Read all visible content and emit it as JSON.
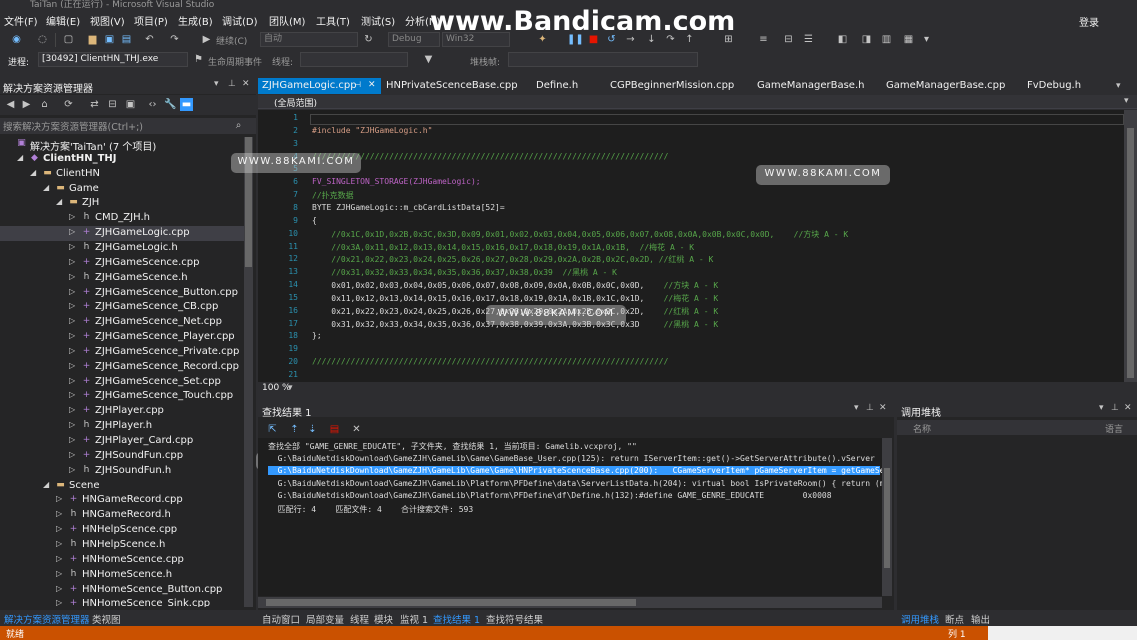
{
  "window": {
    "title": "TaiTan (正在运行) - Microsoft Visual Studio"
  },
  "watermarks": {
    "top": "www.Bandicam.com",
    "site": "WWW.88KAMI.COM"
  },
  "menu": {
    "items": [
      "文件(F)",
      "编辑(E)",
      "视图(V)",
      "项目(P)",
      "生成(B)",
      "调试(D)",
      "团队(M)",
      "工具(T)",
      "测试(S)",
      "分析(N)"
    ],
    "login": "登录"
  },
  "toolbar": {
    "continue_label": "继续(C)",
    "auto_combo": "自动",
    "config_combo": "Debug",
    "platform_combo": "Win32",
    "process_label": "进程:",
    "process_value": "[30492] ClientHN_THJ.exe",
    "lifecycle_label": "生命周期事件",
    "thread_label": "线程:",
    "stackframe_label": "堆栈帧:"
  },
  "solution_explorer": {
    "title": "解决方案资源管理器",
    "search_placeholder": "搜索解决方案资源管理器(Ctrl+;)",
    "tree": [
      {
        "label": "解决方案'TaiTan' (7 个项目)",
        "indent": 0,
        "icon": "solution-icon",
        "arrow": ""
      },
      {
        "label": "ClientHN_THJ",
        "indent": 1,
        "icon": "project-icon",
        "arrow": "◢",
        "bold": true
      },
      {
        "label": "ClientHN",
        "indent": 2,
        "icon": "folder-icon",
        "arrow": "◢"
      },
      {
        "label": "Game",
        "indent": 3,
        "icon": "folder-icon",
        "arrow": "◢"
      },
      {
        "label": "ZJH",
        "indent": 4,
        "icon": "folder-icon",
        "arrow": "◢"
      },
      {
        "label": "CMD_ZJH.h",
        "indent": 5,
        "icon": "header-icon",
        "arrow": "▷"
      },
      {
        "label": "ZJHGameLogic.cpp",
        "indent": 5,
        "icon": "cpp-icon",
        "arrow": "▷",
        "selected": true
      },
      {
        "label": "ZJHGameLogic.h",
        "indent": 5,
        "icon": "header-icon",
        "arrow": "▷"
      },
      {
        "label": "ZJHGameScence.cpp",
        "indent": 5,
        "icon": "cpp-icon",
        "arrow": "▷"
      },
      {
        "label": "ZJHGameScence.h",
        "indent": 5,
        "icon": "header-icon",
        "arrow": "▷"
      },
      {
        "label": "ZJHGameScence_Button.cpp",
        "indent": 5,
        "icon": "cpp-icon",
        "arrow": "▷"
      },
      {
        "label": "ZJHGameScence_CB.cpp",
        "indent": 5,
        "icon": "cpp-icon",
        "arrow": "▷"
      },
      {
        "label": "ZJHGameScence_Net.cpp",
        "indent": 5,
        "icon": "cpp-icon",
        "arrow": "▷"
      },
      {
        "label": "ZJHGameScence_Player.cpp",
        "indent": 5,
        "icon": "cpp-icon",
        "arrow": "▷"
      },
      {
        "label": "ZJHGameScence_Private.cpp",
        "indent": 5,
        "icon": "cpp-icon",
        "arrow": "▷"
      },
      {
        "label": "ZJHGameScence_Record.cpp",
        "indent": 5,
        "icon": "cpp-icon",
        "arrow": "▷"
      },
      {
        "label": "ZJHGameScence_Set.cpp",
        "indent": 5,
        "icon": "cpp-icon",
        "arrow": "▷"
      },
      {
        "label": "ZJHGameScence_Touch.cpp",
        "indent": 5,
        "icon": "cpp-icon",
        "arrow": "▷"
      },
      {
        "label": "ZJHPlayer.cpp",
        "indent": 5,
        "icon": "cpp-icon",
        "arrow": "▷"
      },
      {
        "label": "ZJHPlayer.h",
        "indent": 5,
        "icon": "header-icon",
        "arrow": "▷"
      },
      {
        "label": "ZJHPlayer_Card.cpp",
        "indent": 5,
        "icon": "cpp-icon",
        "arrow": "▷"
      },
      {
        "label": "ZJHSoundFun.cpp",
        "indent": 5,
        "icon": "cpp-icon",
        "arrow": "▷"
      },
      {
        "label": "ZJHSoundFun.h",
        "indent": 5,
        "icon": "header-icon",
        "arrow": "▷"
      },
      {
        "label": "Scene",
        "indent": 3,
        "icon": "folder-icon",
        "arrow": "◢"
      },
      {
        "label": "HNGameRecord.cpp",
        "indent": 4,
        "icon": "cpp-icon",
        "arrow": "▷"
      },
      {
        "label": "HNGameRecord.h",
        "indent": 4,
        "icon": "header-icon",
        "arrow": "▷"
      },
      {
        "label": "HNHelpScence.cpp",
        "indent": 4,
        "icon": "cpp-icon",
        "arrow": "▷"
      },
      {
        "label": "HNHelpScence.h",
        "indent": 4,
        "icon": "header-icon",
        "arrow": "▷"
      },
      {
        "label": "HNHomeScence.cpp",
        "indent": 4,
        "icon": "cpp-icon",
        "arrow": "▷"
      },
      {
        "label": "HNHomeScence.h",
        "indent": 4,
        "icon": "header-icon",
        "arrow": "▷"
      },
      {
        "label": "HNHomeScence_Button.cpp",
        "indent": 4,
        "icon": "cpp-icon",
        "arrow": "▷"
      },
      {
        "label": "HNHomeScence_Sink.cpp",
        "indent": 4,
        "icon": "cpp-icon",
        "arrow": "▷"
      }
    ],
    "bottom_tabs": [
      "解决方案资源管理器",
      "类视图"
    ]
  },
  "editor": {
    "tabs": [
      {
        "label": "ZJHGameLogic.cpp",
        "active": true
      },
      {
        "label": "HNPrivateScenceBase.cpp"
      },
      {
        "label": "Define.h"
      },
      {
        "label": "CGPBeginnerMission.cpp"
      },
      {
        "label": "GameManagerBase.h"
      },
      {
        "label": "GameManagerBase.cpp"
      },
      {
        "label": "FvDebug.h"
      }
    ],
    "scope": "(全局范围)",
    "zoom": "100 %",
    "line_numbers": [
      "1",
      "2",
      "3",
      "4",
      "5",
      "6",
      "7",
      "8",
      "9",
      "10",
      "11",
      "12",
      "13",
      "14",
      "15",
      "16",
      "17",
      "18",
      "19",
      "20",
      "21"
    ],
    "lines": [
      {
        "t": "",
        "c": ""
      },
      {
        "t": "#include \"ZJHGameLogic.h\"",
        "c": "str"
      },
      {
        "t": "",
        "c": ""
      },
      {
        "t": "//////////////////////////////////////////////////////////////////////////",
        "c": "green"
      },
      {
        "t": "",
        "c": ""
      },
      {
        "t": "FV_SINGLETON_STORAGE(ZJHGameLogic);",
        "c": "macro"
      },
      {
        "t": "//扑克数据",
        "c": "green"
      },
      {
        "t": "BYTE ZJHGameLogic::m_cbCardListData[52]=",
        "c": ""
      },
      {
        "t": "{",
        "c": ""
      },
      {
        "t": "    //0x1C,0x1D,0x2B,0x3C,0x3D,0x09,0x01,0x02,0x03,0x04,0x05,0x06,0x07,0x08,0x0A,0x0B,0x0C,0x0D,    //方块 A - K",
        "c": "green"
      },
      {
        "t": "    //0x3A,0x11,0x12,0x13,0x14,0x15,0x16,0x17,0x18,0x19,0x1A,0x1B,  //梅花 A - K",
        "c": "green"
      },
      {
        "t": "    //0x21,0x22,0x23,0x24,0x25,0x26,0x27,0x28,0x29,0x2A,0x2B,0x2C,0x2D, //红桃 A - K",
        "c": "green"
      },
      {
        "t": "    //0x31,0x32,0x33,0x34,0x35,0x36,0x37,0x38,0x39  //黑桃 A - K",
        "c": "green"
      },
      {
        "t": "    0x01,0x02,0x03,0x04,0x05,0x06,0x07,0x08,0x09,0x0A,0x0B,0x0C,0x0D,    //方块 A - K",
        "c": "mixed"
      },
      {
        "t": "    0x11,0x12,0x13,0x14,0x15,0x16,0x17,0x18,0x19,0x1A,0x1B,0x1C,0x1D,    //梅花 A - K",
        "c": "mixed"
      },
      {
        "t": "    0x21,0x22,0x23,0x24,0x25,0x26,0x27,0x28,0x29,0x2A,0x2B,0x2C,0x2D,    //红桃 A - K",
        "c": "mixed"
      },
      {
        "t": "    0x31,0x32,0x33,0x34,0x35,0x36,0x37,0x38,0x39,0x3A,0x3B,0x3C,0x3D     //黑桃 A - K",
        "c": "mixed"
      },
      {
        "t": "};",
        "c": ""
      },
      {
        "t": "",
        "c": ""
      },
      {
        "t": "//////////////////////////////////////////////////////////////////////////",
        "c": "green"
      },
      {
        "t": "",
        "c": ""
      }
    ]
  },
  "find_results": {
    "title": "查找结果 1",
    "lines": [
      {
        "t": "查找全部 \"GAME_GENRE_EDUCATE\", 子文件夹, 查找结果 1, 当前项目: Gamelib.vcxproj, \"\"",
        "hl": false
      },
      {
        "t": "  G:\\BaiduNetdiskDownload\\GameZJH\\GameLib\\Game\\GameBase_User.cpp(125): return IServerItem::get()->GetServerAttribute().vServer",
        "hl": false
      },
      {
        "t": "  G:\\BaiduNetdiskDownload\\GameZJH\\GameLib\\Game\\Game\\HNPrivateScenceBase.cpp(200):   CGameServerItem* pGameServerItem = getGameServer",
        "hl": true
      },
      {
        "t": "  G:\\BaiduNetdiskDownload\\GameZJH\\GameLib\\Platform\\PFDefine\\data\\ServerListData.h(204): virtual bool IsPrivateRoom() { return (m",
        "hl": false
      },
      {
        "t": "  G:\\BaiduNetdiskDownload\\GameZJH\\GameLib\\Platform\\PFDefine\\df\\Define.h(132):#define GAME_GENRE_EDUCATE        0x0008",
        "hl": false
      },
      {
        "t": "  匹配行: 4    匹配文件: 4    合计搜索文件: 593",
        "hl": false
      }
    ]
  },
  "bottom_tabs_mid": [
    "自动窗口",
    "局部变量",
    "线程",
    "模块",
    "监视 1",
    "查找结果 1",
    "查找符号结果"
  ],
  "call_stack": {
    "title": "调用堆栈",
    "col_name": "名称",
    "col_lang": "语言",
    "bottom_tabs": [
      "调用堆栈",
      "断点",
      "输出"
    ]
  },
  "status": {
    "text": "就绪",
    "col": "列 1"
  },
  "colors": {
    "accent": "#007acc",
    "status_bar": "#ca5100",
    "comment": "#57a64a",
    "string": "#d69d85"
  }
}
